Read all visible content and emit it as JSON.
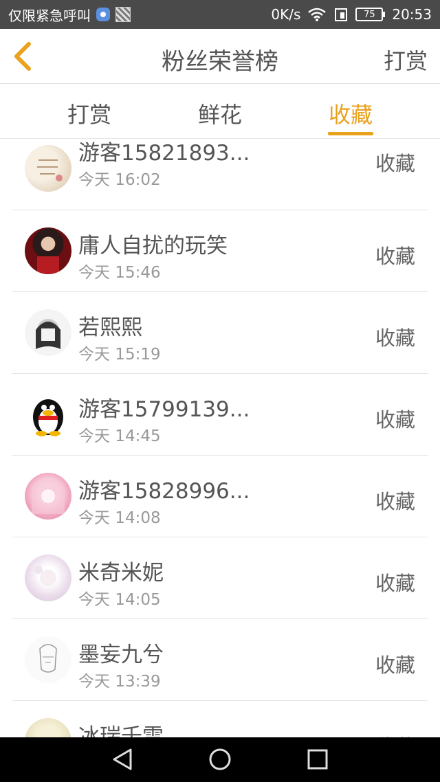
{
  "status_bar": {
    "carrier": "仅限紧急呼叫",
    "speed": "0K/s",
    "battery": "75",
    "time": "20:53"
  },
  "header": {
    "title": "粉丝荣誉榜",
    "action": "打赏"
  },
  "tabs": [
    {
      "label": "打赏",
      "active": false
    },
    {
      "label": "鲜花",
      "active": false
    },
    {
      "label": "收藏",
      "active": true
    }
  ],
  "accent_color": "#eaa21d",
  "fans": [
    {
      "name": "游客15821893...",
      "time": "今天 16:02",
      "type": "收藏"
    },
    {
      "name": "庸人自扰的玩笑",
      "time": "今天 15:46",
      "type": "收藏"
    },
    {
      "name": "若熙熙",
      "time": "今天 15:19",
      "type": "收藏"
    },
    {
      "name": "游客15799139...",
      "time": "今天 14:45",
      "type": "收藏"
    },
    {
      "name": "游客15828996...",
      "time": "今天 14:08",
      "type": "收藏"
    },
    {
      "name": "米奇米妮",
      "time": "今天 14:05",
      "type": "收藏"
    },
    {
      "name": "墨妄九兮",
      "time": "今天 13:39",
      "type": "收藏"
    },
    {
      "name": "冰瑞千雪",
      "time": "",
      "type": "收藏"
    }
  ],
  "nav_icons": [
    "back-triangle-icon",
    "home-circle-icon",
    "recents-square-icon"
  ]
}
